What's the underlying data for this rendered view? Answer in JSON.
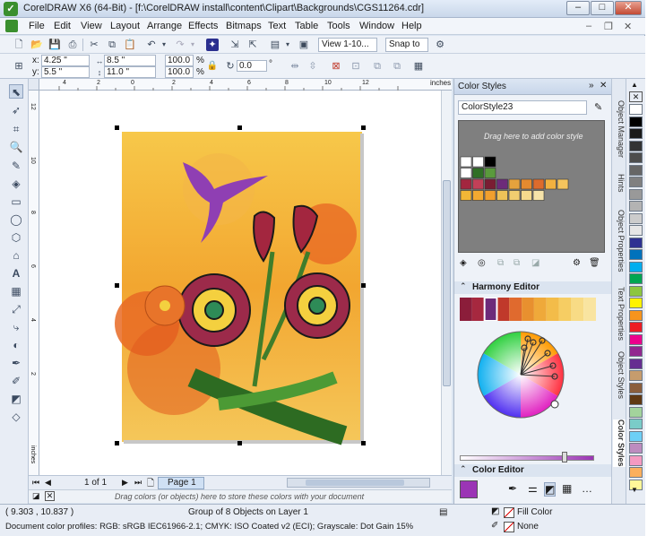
{
  "window": {
    "title": "CorelDRAW X6 (64-Bit) - [f:\\CorelDRAW install\\content\\Clipart\\Backgrounds\\CGS11264.cdr]",
    "minimize": "–",
    "maximize": "□",
    "close": "✕"
  },
  "menu": [
    "File",
    "Edit",
    "View",
    "Layout",
    "Arrange",
    "Effects",
    "Bitmaps",
    "Text",
    "Table",
    "Tools",
    "Window",
    "Help"
  ],
  "toolbar": {
    "zoom_view": "View 1-10...",
    "snap_to": "Snap to"
  },
  "propbar": {
    "x_label": "x:",
    "x": "4.25 \"",
    "y_label": "y:",
    "y": "5.5 \"",
    "w": "8.5 \"",
    "h": "11.0 \"",
    "scale_w": "100.0",
    "scale_h": "100.0",
    "pct": "%",
    "rotation": "0.0",
    "deg": "°"
  },
  "ruler": {
    "unit": "inches",
    "ticks": [
      "4",
      "2",
      "0",
      "2",
      "4",
      "6",
      "8",
      "10",
      "12"
    ],
    "left_ticks": [
      "12",
      "10",
      "8",
      "6",
      "4",
      "2"
    ]
  },
  "pagenav": {
    "position": "1 of 1",
    "tab": "Page 1"
  },
  "colorbar": {
    "hint": "Drag colors (or objects) here to store these colors with your document"
  },
  "status": {
    "coords": "( 9.303 , 10.837 )",
    "selection": "Group of 8 Objects on Layer 1",
    "profiles": "Document color profiles: RGB: sRGB IEC61966-2.1; CMYK: ISO Coated v2 (ECI); Grayscale: Dot Gain 15%",
    "fill": "Fill Color",
    "outline": "None"
  },
  "docker": {
    "title": "Color Styles",
    "style_name": "ColorStyle23",
    "drop_hint": "Drag here to add color style",
    "harmony": "Harmony Editor",
    "color_editor": "Color Editor"
  },
  "dock_tabs": [
    "Object Manager",
    "Hints",
    "Object Properties",
    "Text Properties",
    "Object Styles",
    "Color Styles"
  ],
  "colors": {
    "accent": "#3a8f2e",
    "docker_gray": "#7f7f7f",
    "current_color": "#9b35b5"
  },
  "palette": [
    "#ffffff",
    "#000000",
    "#1a1a1a",
    "#333333",
    "#4d4d4d",
    "#666666",
    "#808080",
    "#999999",
    "#b3b3b3",
    "#cccccc",
    "#e6e6e6",
    "#2e3192",
    "#0072bc",
    "#00aeef",
    "#00a651",
    "#8dc63f",
    "#fff200",
    "#f7941d",
    "#ed1c24",
    "#ec008c",
    "#92278f",
    "#662d91",
    "#c69c6d",
    "#8b5e3c",
    "#603913",
    "#a3d39c",
    "#7accc8",
    "#6dcff6",
    "#bd8cbf",
    "#f49ac1",
    "#fbaf5d",
    "#fff799"
  ],
  "harmony_swatches": [
    "#8b1d3a",
    "#a6283f",
    "#6d2b7a",
    "#c0392b",
    "#e06a2e",
    "#e8902f",
    "#efa93a",
    "#f3bc49",
    "#f6cd63",
    "#f8db85",
    "#f9e4a0"
  ],
  "style_grid": [
    [
      "#ffffff",
      "#ffffff",
      "#000000",
      "",
      ""
    ],
    [
      "#ffffff",
      "#2f6f25",
      "#5a9a3c",
      "",
      ""
    ],
    [
      "#a3263f",
      "#c24058",
      "#7a1d33",
      "#6d2b7a",
      "#e5a23d",
      "#e58a2f",
      "#dd6b2c",
      "#f2b13f",
      "#f4c45d"
    ],
    [
      "#f3b736",
      "#f2a931",
      "#f09f2e",
      "#eec258",
      "#f1cd70",
      "#f5d98d",
      "#f6e3a9"
    ]
  ]
}
